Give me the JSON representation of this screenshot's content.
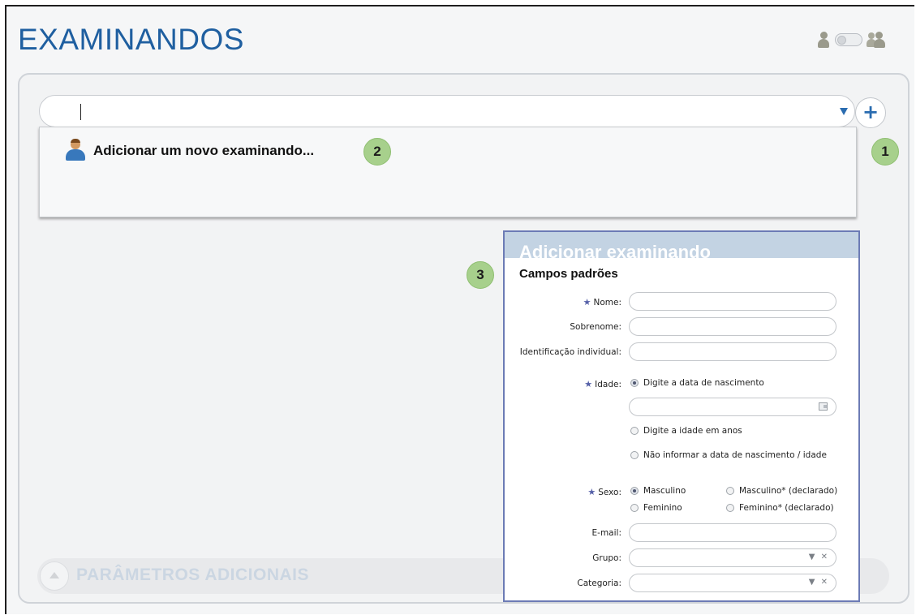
{
  "page": {
    "title": "EXAMINANDOS",
    "params_label": "PARÂMETROS ADICIONAIS"
  },
  "top_icons": [
    "person-icon",
    "toggle-switch",
    "group-icon"
  ],
  "search": {
    "value": "",
    "placeholder": ""
  },
  "add_button": {
    "label": "+"
  },
  "suggestion": {
    "icon": "person-add-icon",
    "label": "Adicionar um novo examinando..."
  },
  "badges": {
    "one": "1",
    "two": "2",
    "three": "3"
  },
  "dialog": {
    "title": "Adicionar examinando",
    "section": "Campos padrões",
    "fields": {
      "nome": {
        "label": "Nome:",
        "required": true,
        "value": ""
      },
      "sobrenome": {
        "label": "Sobrenome:",
        "value": ""
      },
      "identificacao": {
        "label": "Identificação individual:",
        "value": ""
      },
      "idade": {
        "label": "Idade:",
        "required": true,
        "options": [
          "Digite a data de nascimento",
          "Digite a idade em anos",
          "Não informar a data de nascimento / idade"
        ],
        "selected": "Digite a data de nascimento",
        "date_value": ""
      },
      "sexo": {
        "label": "Sexo:",
        "required": true,
        "options": [
          "Masculino",
          "Masculino* (declarado)",
          "Feminino",
          "Feminino* (declarado)"
        ],
        "selected": "Masculino"
      },
      "email": {
        "label": "E-mail:",
        "value": ""
      },
      "grupo": {
        "label": "Grupo:",
        "value": ""
      },
      "categoria": {
        "label": "Categoria:",
        "value": ""
      }
    },
    "select_controls": "▼ ✕"
  },
  "colors": {
    "title": "#1f5fa0",
    "badge": "#a7d08c",
    "dialog_border": "#6c7bb5",
    "dialog_header": "#c3d3e3",
    "required_star": "#5560a8"
  }
}
